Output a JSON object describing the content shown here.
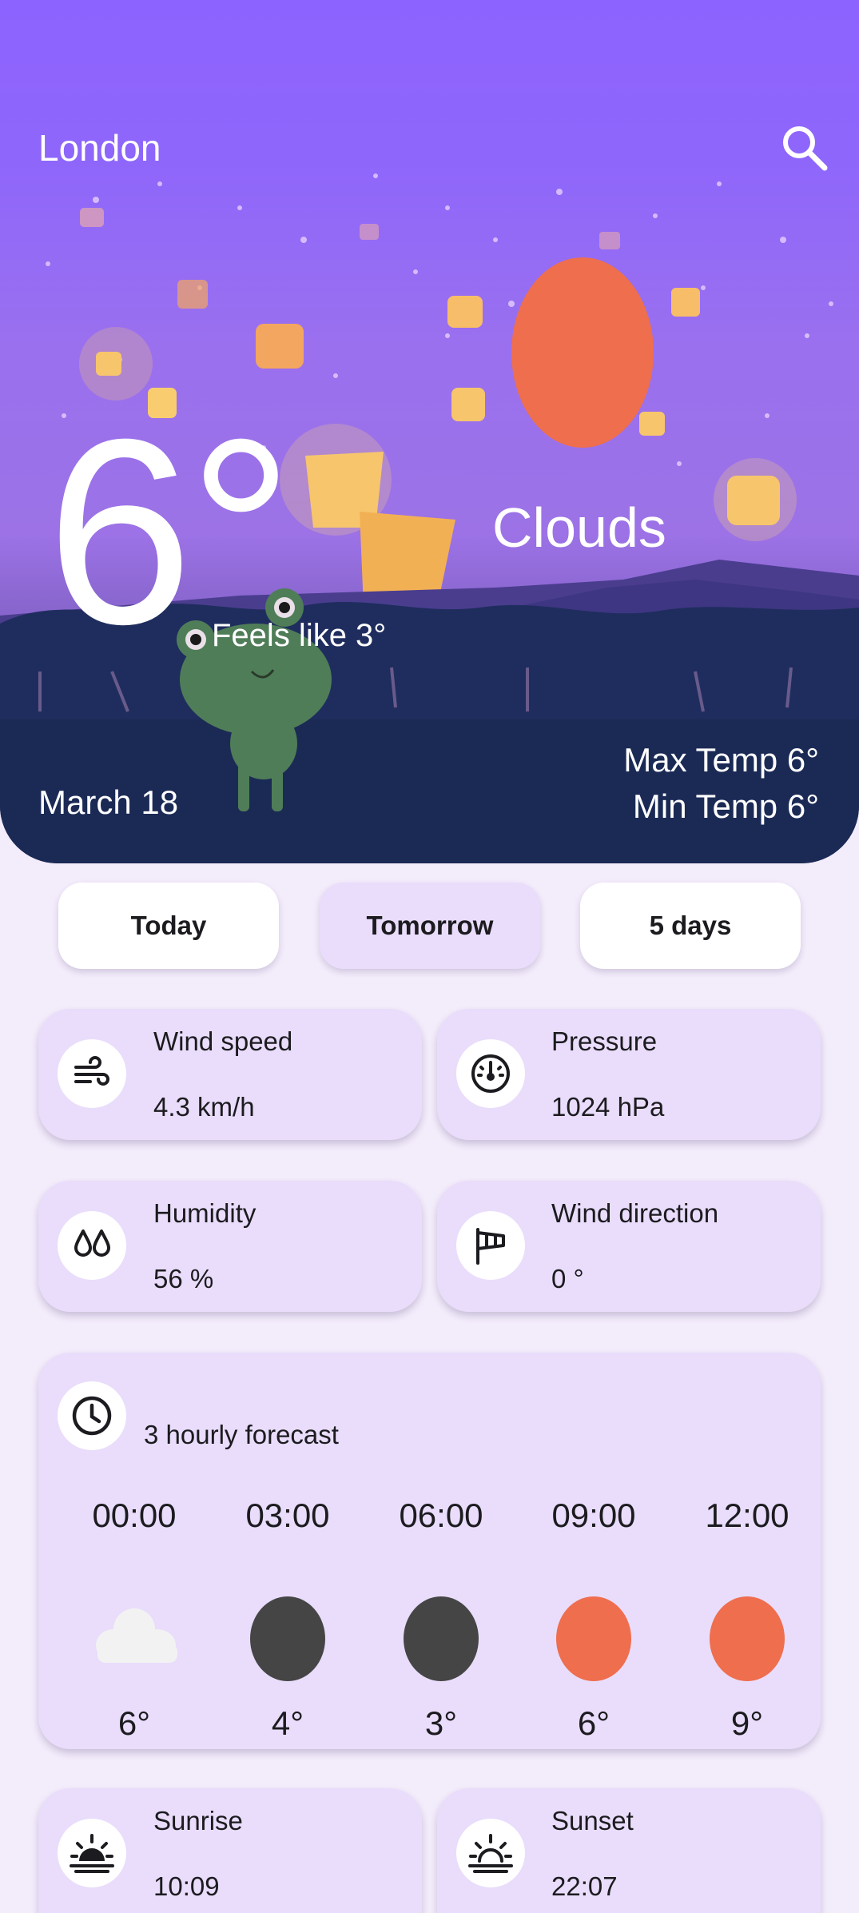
{
  "location": {
    "city": "London"
  },
  "current": {
    "temperature": "6°",
    "condition": "Clouds",
    "feels_like": "Feels like 3°",
    "date": "March 18",
    "max_temp": "Max Temp 6°",
    "min_temp": "Min Temp 6°"
  },
  "tabs": [
    {
      "label": "Today",
      "active": false
    },
    {
      "label": "Tomorrow",
      "active": true
    },
    {
      "label": "5 days",
      "active": false
    }
  ],
  "stats": {
    "wind_speed": {
      "label": "Wind speed",
      "value": "4.3 km/h",
      "icon": "wind-icon"
    },
    "pressure": {
      "label": "Pressure",
      "value": "1024 hPa",
      "icon": "gauge-icon"
    },
    "humidity": {
      "label": "Humidity",
      "value": "56 %",
      "icon": "droplets-icon"
    },
    "wind_direction": {
      "label": "Wind direction",
      "value": "0 °",
      "icon": "windsock-icon"
    },
    "sunrise": {
      "label": "Sunrise",
      "value": "10:09",
      "icon": "sunrise-icon"
    },
    "sunset": {
      "label": "Sunset",
      "value": "22:07",
      "icon": "sunset-icon"
    }
  },
  "forecast": {
    "title": "3 hourly forecast",
    "icon": "clock-icon",
    "items": [
      {
        "time": "00:00",
        "temp": "6°",
        "icon": "cloud-icon",
        "color": "#f2f2f2"
      },
      {
        "time": "03:00",
        "temp": "4°",
        "icon": "moon-icon",
        "color": "#454545"
      },
      {
        "time": "06:00",
        "temp": "3°",
        "icon": "moon-icon",
        "color": "#454545"
      },
      {
        "time": "09:00",
        "temp": "6°",
        "icon": "sun-icon",
        "color": "#ee6e4e"
      },
      {
        "time": "12:00",
        "temp": "9°",
        "icon": "sun-icon",
        "color": "#ee6e4e"
      }
    ]
  },
  "colors": {
    "accent": "#8d63ff",
    "card": "#e9ddfb",
    "background": "#f3ecfb",
    "sun": "#ee6e4e"
  }
}
